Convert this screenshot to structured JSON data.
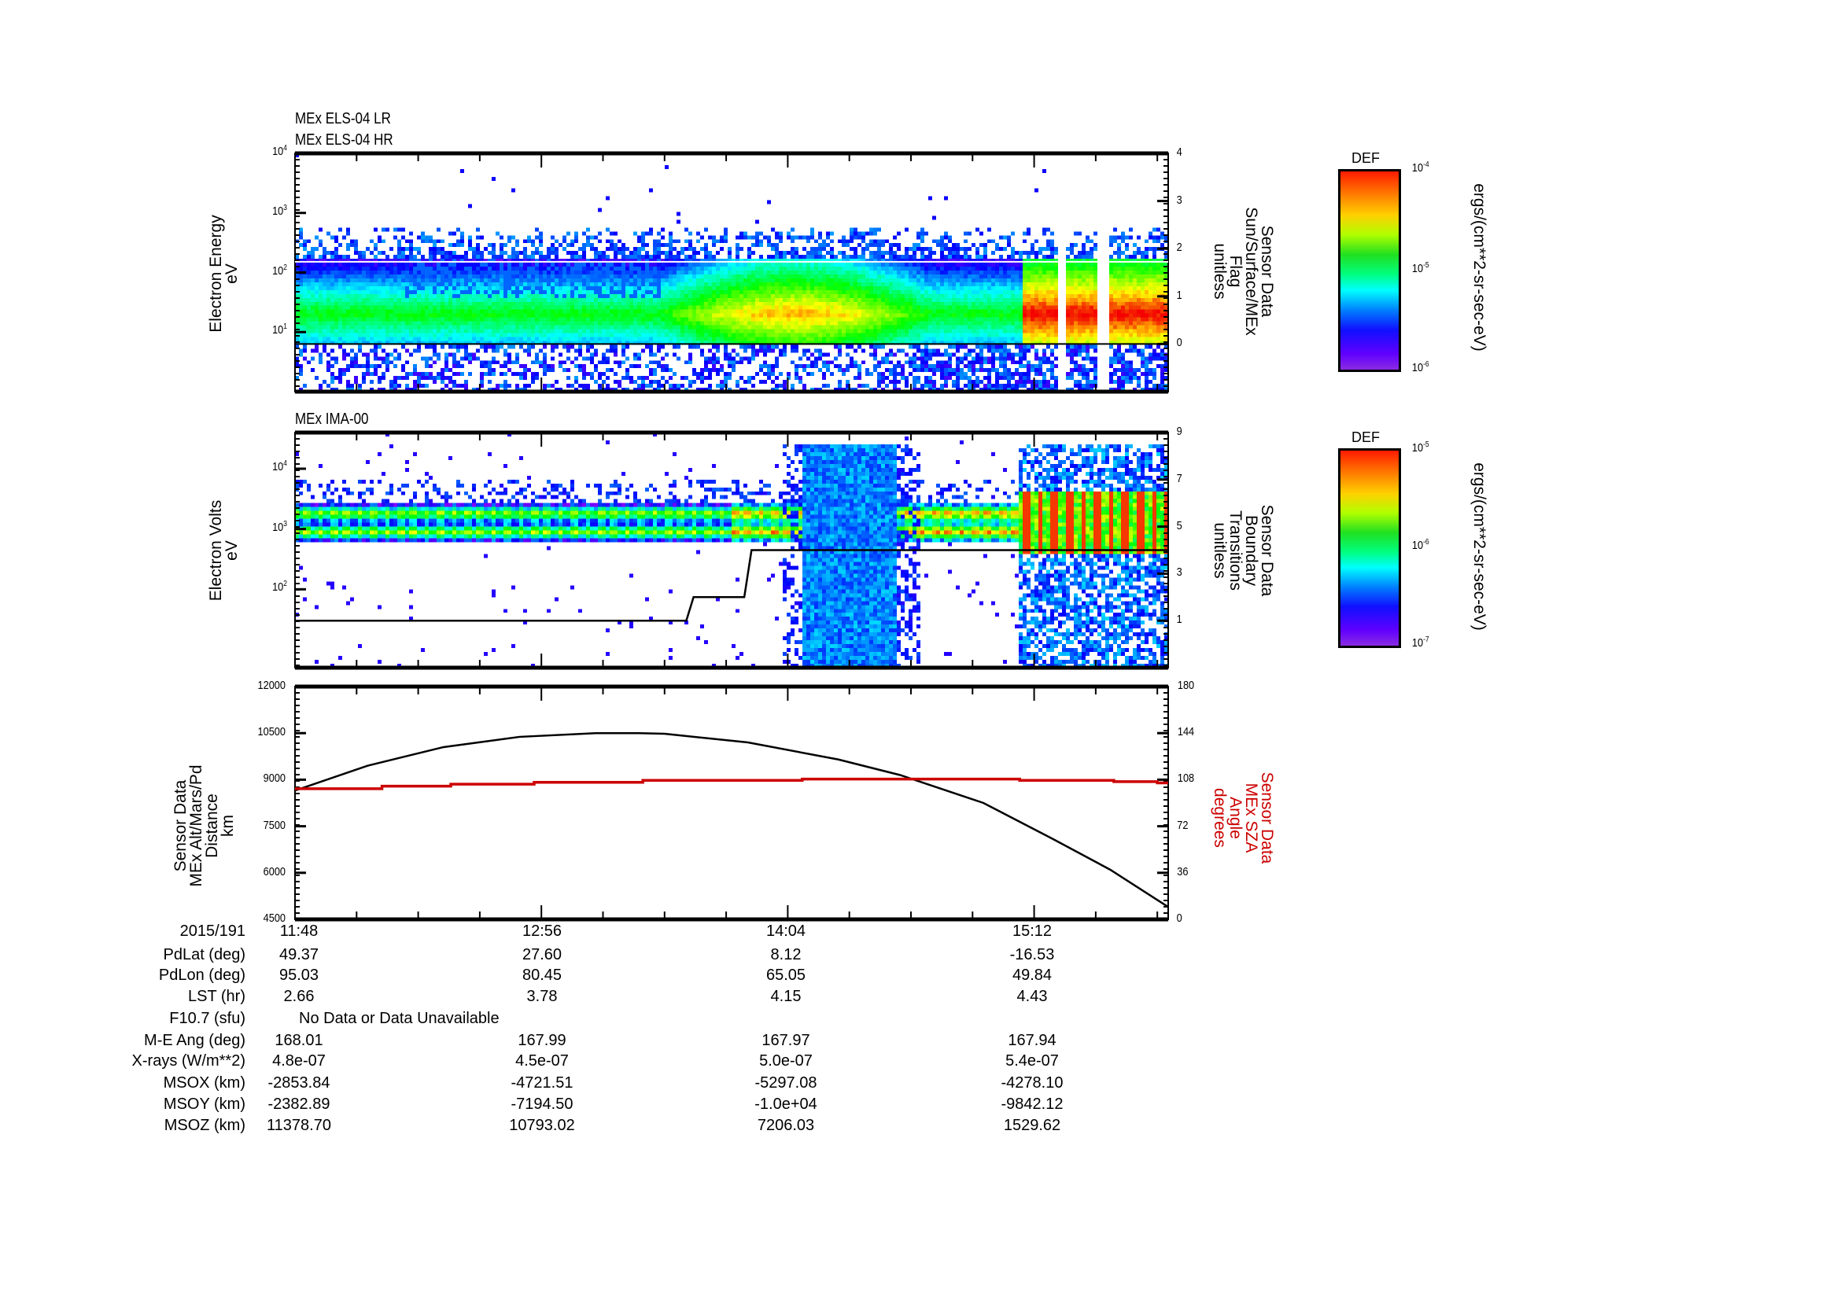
{
  "panels": {
    "els": {
      "titles": [
        "MEx ELS-04 LR",
        "MEx ELS-04 HR"
      ],
      "ylabel": [
        "Electron Energy",
        "eV"
      ],
      "ylabel_right": [
        "Sensor Data",
        "Sun/Surface/MEx",
        "Flag",
        "unitless"
      ],
      "yticks": [
        {
          "base": "10",
          "exp": "1"
        },
        {
          "base": "10",
          "exp": "2"
        },
        {
          "base": "10",
          "exp": "3"
        },
        {
          "base": "10",
          "exp": "4"
        }
      ],
      "yticks_right": [
        "0",
        "1",
        "2",
        "3",
        "4"
      ],
      "colorbar": {
        "title": "DEF",
        "top": {
          "base": "10",
          "exp": "-4"
        },
        "mid": {
          "base": "10",
          "exp": "-5"
        },
        "bottom": {
          "base": "10",
          "exp": "-6"
        },
        "units": "ergs/(cm**2-sr-sec-eV)"
      }
    },
    "ima": {
      "titles": [
        "MEx IMA-00"
      ],
      "ylabel": [
        "Electron Volts",
        "eV"
      ],
      "ylabel_right": [
        "Sensor Data",
        "Boundary",
        "Transitions",
        "unitless"
      ],
      "yticks": [
        {
          "base": "10",
          "exp": "2"
        },
        {
          "base": "10",
          "exp": "3"
        },
        {
          "base": "10",
          "exp": "4"
        }
      ],
      "yticks_right": [
        "1",
        "3",
        "5",
        "7",
        "9"
      ],
      "colorbar": {
        "title": "DEF",
        "top": {
          "base": "10",
          "exp": "-5"
        },
        "mid": {
          "base": "10",
          "exp": "-6"
        },
        "bottom": {
          "base": "10",
          "exp": "-7"
        },
        "units": "ergs/(cm**2-sr-sec-eV)"
      }
    },
    "orbit": {
      "ylabel": [
        "Sensor Data",
        "MEx Alt/Mars/Pd",
        "Distance",
        "km"
      ],
      "ylabel_right": [
        "Sensor Data",
        "MEx SZA",
        "Angle",
        "degrees"
      ],
      "yticks": [
        "4500",
        "6000",
        "7500",
        "9000",
        "10500",
        "12000"
      ],
      "yticks_right": [
        "0",
        "36",
        "72",
        "108",
        "144",
        "180"
      ]
    }
  },
  "chart_data": [
    {
      "type": "heatmap",
      "title": "MEx ELS-04 LR / MEx ELS-04 HR",
      "ylabel": "Electron Energy (eV)",
      "yscale": "log",
      "ylim": [
        1,
        10000
      ],
      "xlim_minutes_after_1148": [
        0,
        241
      ],
      "colorbar": {
        "label": "DEF",
        "range": [
          1e-06,
          0.0001
        ],
        "units": "ergs/(cm**2-sr-sec-eV)"
      },
      "features": [
        {
          "t_min": [
            0,
            241
          ],
          "log_energy": [
            0.8,
            2.2
          ],
          "level": 0.55
        },
        {
          "t_min": [
            100,
            175
          ],
          "log_energy": [
            1.0,
            1.6
          ],
          "level": 0.85
        },
        {
          "t_min": [
            200,
            241
          ],
          "log_energy": [
            1.05,
            1.8
          ],
          "level": 1.0
        }
      ],
      "overlay_flag": {
        "name": "Sun/Surface/MEx Flag",
        "ylim": [
          -1,
          4
        ],
        "t": [
          0,
          241
        ],
        "values": [
          0,
          0
        ]
      }
    },
    {
      "type": "heatmap",
      "title": "MEx IMA-00",
      "ylabel": "Electron Volts (eV)",
      "yscale": "log",
      "ylim": [
        5,
        40000
      ],
      "xlim_minutes_after_1148": [
        0,
        241
      ],
      "colorbar": {
        "label": "DEF",
        "range": [
          1e-07,
          1e-05
        ],
        "units": "ergs/(cm**2-sr-sec-eV)"
      },
      "features": [
        {
          "t_min": [
            0,
            196
          ],
          "log_energy": [
            2.85,
            3.35
          ],
          "level": 0.6
        },
        {
          "t_min": [
            140,
            166
          ],
          "log_energy": [
            0.7,
            4.2
          ],
          "level": 0.22
        },
        {
          "t_min": [
            199,
            241
          ],
          "log_energy": [
            2.6,
            3.6
          ],
          "level": 0.95
        }
      ],
      "overlay_boundary": {
        "name": "Boundary Transitions",
        "ylim": [
          -1,
          9
        ],
        "t": [
          0,
          108,
          110,
          124,
          126,
          241
        ],
        "values": [
          1,
          1,
          2,
          2,
          4,
          4
        ]
      }
    },
    {
      "type": "line",
      "x_label": "2015/191",
      "xlim_minutes_after_1148": [
        0,
        241
      ],
      "series": [
        {
          "name": "MEx Alt/Mars/Pd Distance (km)",
          "axis": "left",
          "color": "#000000",
          "t": [
            0,
            20,
            41,
            62,
            83,
            95,
            102,
            125,
            150,
            167,
            190,
            209,
            225,
            241
          ],
          "values": [
            8650,
            9450,
            10050,
            10380,
            10500,
            10500,
            10480,
            10200,
            9650,
            9150,
            8250,
            7100,
            6100,
            4900
          ]
        },
        {
          "name": "MEx SZA Angle (degrees)",
          "axis": "right",
          "color": "#cc0000",
          "t": [
            0,
            24,
            24,
            43,
            43,
            66,
            66,
            96,
            96,
            140,
            140,
            200,
            200,
            226,
            226,
            238,
            238,
            241
          ],
          "values": [
            101,
            101,
            103,
            103,
            104.5,
            104.5,
            106,
            106,
            107.5,
            107.5,
            108.5,
            108.5,
            107.5,
            107.5,
            106.5,
            106.5,
            105.5,
            105.5
          ]
        }
      ],
      "ylim_left": [
        4500,
        12000
      ],
      "ylim_right": [
        0,
        180
      ]
    }
  ],
  "ephemeris": {
    "date": "2015/191",
    "times": [
      "11:48",
      "12:56",
      "14:04",
      "15:12"
    ],
    "rows": [
      {
        "label": "PdLat (deg)",
        "values": [
          "49.37",
          "27.60",
          "8.12",
          "-16.53"
        ]
      },
      {
        "label": "PdLon (deg)",
        "values": [
          "95.03",
          "80.45",
          "65.05",
          "49.84"
        ]
      },
      {
        "label": "LST (hr)",
        "values": [
          "2.66",
          "3.78",
          "4.15",
          "4.43"
        ]
      },
      {
        "label": "F10.7 (sfu)",
        "note": "No Data or Data Unavailable"
      },
      {
        "label": "M-E Ang (deg)",
        "values": [
          "168.01",
          "167.99",
          "167.97",
          "167.94"
        ]
      },
      {
        "label": "X-rays (W/m**2)",
        "values": [
          "4.8e-07",
          "4.5e-07",
          "5.0e-07",
          "5.4e-07"
        ]
      },
      {
        "label": "MSOX (km)",
        "values": [
          "-2853.84",
          "-4721.51",
          "-5297.08",
          "-4278.10"
        ]
      },
      {
        "label": "MSOY (km)",
        "values": [
          "-2382.89",
          "-7194.50",
          "-1.0e+04",
          "-9842.12"
        ]
      },
      {
        "label": "MSOZ (km)",
        "values": [
          "11378.70",
          "10793.02",
          "7206.03",
          "1529.62"
        ]
      }
    ]
  },
  "colors": {
    "sza": "#cc0000",
    "axis": "#000000"
  }
}
